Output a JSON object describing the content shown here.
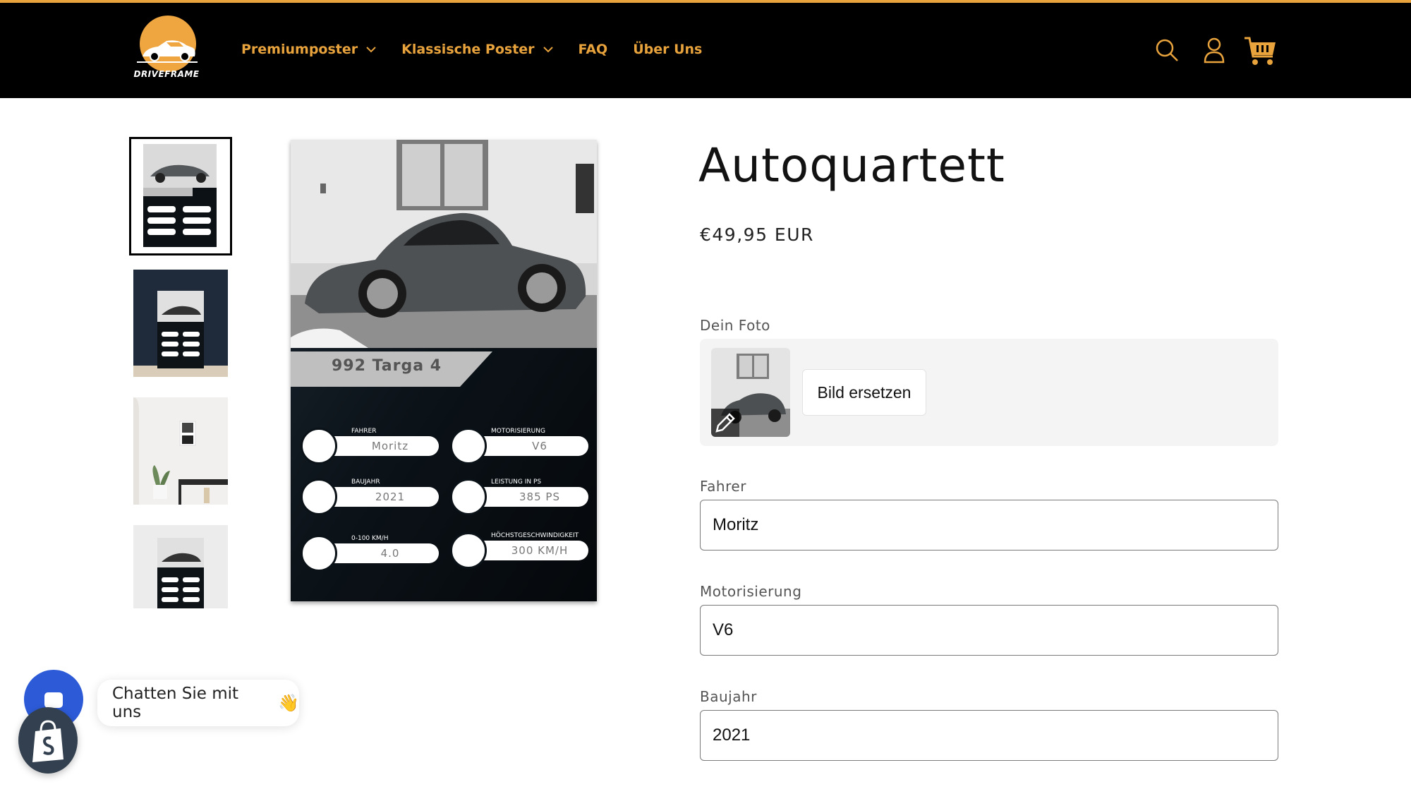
{
  "header": {
    "logo_text": "DRIVEFRAME",
    "nav": [
      {
        "label": "Premiumposter",
        "has_dropdown": true
      },
      {
        "label": "Klassische Poster",
        "has_dropdown": true
      },
      {
        "label": "FAQ",
        "has_dropdown": false
      },
      {
        "label": "Über Uns",
        "has_dropdown": false
      }
    ],
    "icons": [
      "search-icon",
      "account-icon",
      "cart-icon"
    ],
    "accent_color": "#e8a33d",
    "background_color": "#000000"
  },
  "poster": {
    "model": "992 Targa 4",
    "stats": [
      {
        "label": "FAHRER",
        "value": "Moritz",
        "icon": "driver-license-icon"
      },
      {
        "label": "MOTORISIERUNG",
        "value": "V6",
        "icon": "engine-icon"
      },
      {
        "label": "BAUJAHR",
        "value": "2021",
        "icon": "calendar-icon"
      },
      {
        "label": "LEISTUNG IN PS",
        "value": "385 PS",
        "icon": "lightning-icon"
      },
      {
        "label": "0-100 KM/H",
        "value": "4.0",
        "icon": "speedometer-icon"
      },
      {
        "label": "HÖCHSTGESCHWINDIGKEIT",
        "value": "300 KM/H",
        "icon": "gauge-icon"
      }
    ]
  },
  "product": {
    "title": "Autoquartett",
    "price": "€49,95 EUR",
    "photo_label": "Dein Foto",
    "replace_button": "Bild ersetzen",
    "fields": [
      {
        "label": "Fahrer",
        "value": "Moritz"
      },
      {
        "label": "Motorisierung",
        "value": "V6"
      },
      {
        "label": "Baujahr",
        "value": "2021"
      }
    ]
  },
  "chat": {
    "label": "Chatten Sie mit uns",
    "emoji": "👋"
  }
}
